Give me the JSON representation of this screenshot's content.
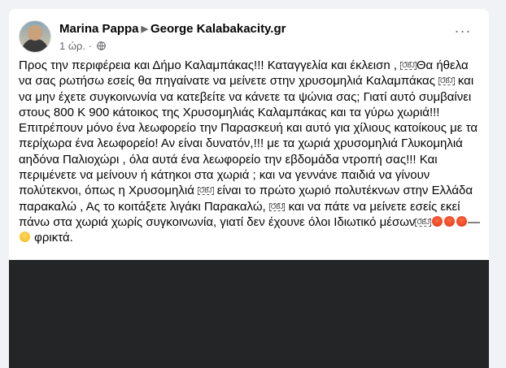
{
  "post": {
    "author": "Marina Pappa",
    "target": "George Kalabakacity.gr",
    "time": "1 ώρ. ·",
    "more_label": "···",
    "obj": "OBJ",
    "seg1": "Προς την περιφέρεια και Δήμο Καλαμπάκας!!! Καταγγελία και έκλεισn ,",
    "seg2": "Θα ήθελα να σας ρωτήσω εσείς θα πηγαίνατε να μείνετε στην χρυσομηλιά Καλαμπάκας",
    "seg3": "και να μην έχετε συγκοινωνία να κατεβείτε να κάνετε τα ψώνια σας; Γιατί αυτό συμβαίνει στους 800 Κ 900 κάτοικος της Χρυσομηλιάς Καλαμπάκας και τα γύρω χωριά!!! Επιτρέπουν μόνο ένα λεωφορείο την Παρασκευή και αυτό για χίλιους κατοίκους με τα περίχωρα ένα λεωφορείο! Αν είναι δυνατόν,!!! με τα χωριά χρυσομηλιά Γλυκομηλιά αηδόνα Παλιοχώρι , όλα αυτά ένα λεωφορείο την εβδομάδα ντροπή σας!!! Και περιμένετε να μείνουν ή κάτηκοι στα χωριά ; και να γεννάνε παιδιά να γίνουν πολύτεκνοι, όπως η Χρυσομηλιά",
    "seg4": "είναι το πρώτο χωριό πολυτέκνων στην Ελλάδα παρακαλώ , Ας το κοιτάξετε λιγάκι Παρακαλώ,",
    "seg5": "και να πάτε να μείνετε εσείς εκεί πάνω στα χωριά χωρίς συγκοινωνία, γιατί δεν έχουνε όλοι Ιδιωτικό μέσων",
    "seg6": "—",
    "seg7": "φρικτά."
  },
  "icons": {
    "avatar": "profile-photo",
    "arrow": "triangle-right-icon",
    "globe": "globe-icon",
    "emoji_angry": "angry-face-emoji",
    "emoji_weary": "weary-face-emoji"
  },
  "colors": {
    "background": "#f0f2f5",
    "card": "#ffffff",
    "text": "#050505",
    "secondary": "#65676b",
    "media": "#242526"
  }
}
